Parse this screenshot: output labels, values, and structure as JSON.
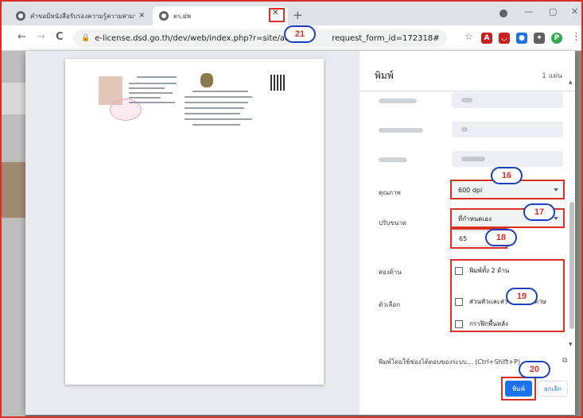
{
  "browser": {
    "tabs": [
      {
        "title": "คำขอมีหนังสือรับรองความรู้ความสามารถ",
        "close": "✕"
      },
      {
        "title": "ตร.ฝพ",
        "close": "✕"
      }
    ],
    "new_tab": "+",
    "address": "e-license.dsd.go.th/dev/web/index.php?r=site/admin",
    "address_suffix": "request_form_id=172318#",
    "window_controls": [
      "—",
      "▢",
      "✕"
    ],
    "nav": {
      "back": "←",
      "forward": "→",
      "reload": "C"
    }
  },
  "print_dialog": {
    "title": "พิมพ์",
    "sheet_count": "1 แผ่น",
    "quality_label": "คุณภาพ",
    "quality_value": "600 dpi",
    "scale_label": "ปรับขนาด",
    "scale_value": "ที่กำหนดเอง",
    "scale_input": "65",
    "two_sided_label": "สองด้าน",
    "two_sided_option": "พิมพ์ทั้ง 2 ด้าน",
    "options_label": "ตัวเลือก",
    "option_headers": "ส่วนหัวและส่วนท้ายกระดาษ",
    "option_background": "กราฟิกพื้นหลัง",
    "system_dialog": "พิมพ์โดยใช้ช่องโต้ตอบของระบบ... (Ctrl+Shift+P)",
    "print_button": "พิมพ์",
    "cancel_button": "ยกเลิก"
  },
  "callouts": [
    "21",
    "16",
    "17",
    "18",
    "19",
    "20"
  ],
  "colors": {
    "highlight": "#d93025",
    "accent": "#1a73e8",
    "callout_border": "#1a3fbf"
  }
}
